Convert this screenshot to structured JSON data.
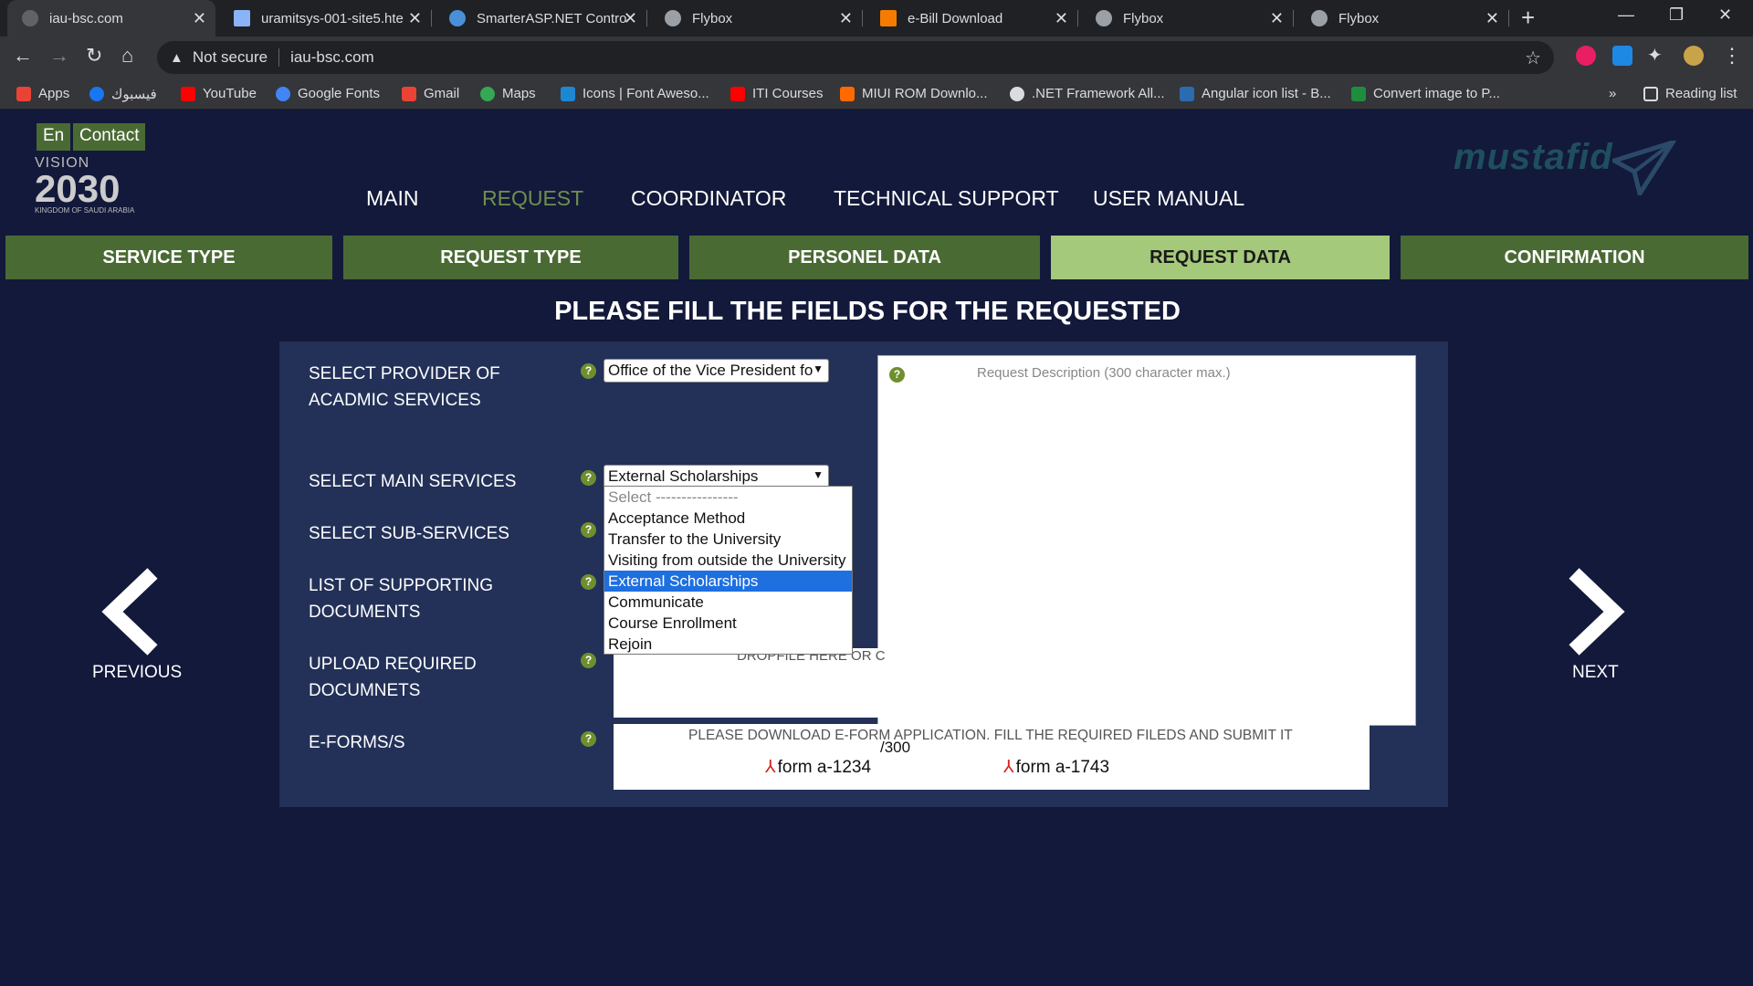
{
  "browser": {
    "tabs": [
      {
        "title": "iau-bsc.com",
        "color": "#5f6368"
      },
      {
        "title": "uramitsys-001-site5.hte",
        "color": "#8ab4f8"
      },
      {
        "title": "SmarterASP.NET Contro",
        "color": "#4a90d9"
      },
      {
        "title": "Flybox",
        "color": "#5f6368"
      },
      {
        "title": "e-Bill Download",
        "color": "#f57c00"
      },
      {
        "title": "Flybox",
        "color": "#5f6368"
      },
      {
        "title": "Flybox",
        "color": "#5f6368"
      }
    ],
    "new_tab": "+",
    "security": "Not secure",
    "url": "iau-bsc.com",
    "bookmarks": [
      {
        "label": "Apps",
        "color": "#ea4335"
      },
      {
        "label": "فيسبوك",
        "color": "#1877f2"
      },
      {
        "label": "YouTube",
        "color": "#ff0000"
      },
      {
        "label": "Google Fonts",
        "color": "#4285f4"
      },
      {
        "label": "Gmail",
        "color": "#ea4335"
      },
      {
        "label": "Maps",
        "color": "#34a853"
      },
      {
        "label": "Icons | Font Aweso...",
        "color": "#1c88d4"
      },
      {
        "label": "ITI Courses",
        "color": "#ff0000"
      },
      {
        "label": "MIUI ROM Downlo...",
        "color": "#ff6900"
      },
      {
        "label": ".NET Framework All...",
        "color": "#dadce0"
      },
      {
        "label": "Angular icon list - B...",
        "color": "#2b6cb0"
      },
      {
        "label": "Convert image to P...",
        "color": "#1e8e3e"
      }
    ],
    "more_bookmarks": "»",
    "reading_list": "Reading list"
  },
  "header": {
    "lang_button": "En",
    "contact_button": "Contact",
    "vision_logo_text": [
      "VISION",
      "2030",
      "KINGDOM OF SAUDI ARABIA"
    ],
    "brand_logo_text": "mustafid",
    "nav": [
      "MAIN",
      "REQUEST",
      "COORDINATOR",
      "TECHNICAL SUPPORT",
      "USER MANUAL"
    ],
    "active_nav": "REQUEST"
  },
  "steps": [
    "SERVICE TYPE",
    "REQUEST TYPE",
    "PERSONEL DATA",
    "REQUEST DATA",
    "CONFIRMATION"
  ],
  "current_step": "REQUEST DATA",
  "heading": "PLEASE FILL THE FIELDS FOR THE REQUESTED",
  "form": {
    "provider_label": "SELECT PROVIDER OF ACADMIC SERVICES",
    "provider_value": "Office of the Vice President fo",
    "main_services_label": "SELECT MAIN SERVICES",
    "main_services_value": "External Scholarships",
    "main_services_options": [
      "Select ----------------",
      "Acceptance Method",
      "Transfer to the University",
      "Visiting from outside the University",
      "External Scholarships",
      "Communicate",
      "Course Enrollment",
      "Rejoin"
    ],
    "sub_services_label": "SELECT SUB-SERVICES",
    "supporting_docs_label": "LIST OF SUPPORTING DOCUMENTS",
    "upload_label": "UPLOAD REQUIRED DOCUMNETS",
    "upload_hint": "DROPFILE HERE OR C",
    "eforms_label": "E-FORMS/S",
    "eforms_hint": "PLEASE DOWNLOAD E-FORM APPLICATION. FILL THE REQUIRED FILEDS AND SUBMIT IT",
    "char_counter": "/300",
    "eform_links": [
      "form a-1234",
      "form a-1743"
    ],
    "description_placeholder": "Request Description (300 character max.)",
    "help_glyph": "?"
  },
  "pager": {
    "previous": "PREVIOUS",
    "next": "NEXT"
  },
  "colors": {
    "page_bg": "#13193a",
    "panel_bg": "#233158",
    "step_bg": "#4a6a34",
    "step_active": "#a5c97a"
  }
}
